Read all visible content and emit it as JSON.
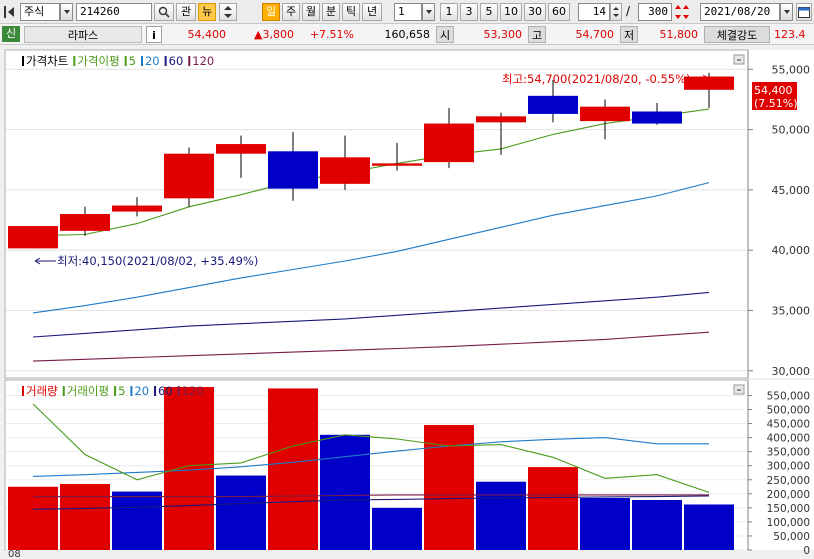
{
  "toolbar": {
    "market_type": "주식",
    "stock_code": "214260",
    "btn_gwan": "관",
    "btn_news": "뉴",
    "period_buttons": [
      "일",
      "주",
      "월",
      "분",
      "틱",
      "년"
    ],
    "interval_value": "1",
    "interval_buttons": [
      "1",
      "3",
      "5",
      "10",
      "30",
      "60"
    ],
    "count_value": "14",
    "divider": "/",
    "total_value": "300",
    "date_value": "2021/08/20"
  },
  "quote_bar": {
    "badge": "신",
    "stock_name": "라파스",
    "info_button": "i",
    "price": "54,400",
    "change": "▲3,800",
    "change_pct": "+7.51%",
    "volume": "160,658",
    "open_label": "시",
    "open": "53,300",
    "high_label": "고",
    "high": "54,700",
    "low_label": "저",
    "low": "51,800",
    "strength_label": "체결강도",
    "strength": "123.4"
  },
  "colors": {
    "up": "#e00000",
    "down": "#0000c8",
    "ma5": "#4c9a1a",
    "ma20": "#1e7ac8",
    "ma60": "#1a1a7a",
    "ma120": "#7a1a4a"
  },
  "chart_data": [
    {
      "type": "candlestick",
      "legend": [
        {
          "label": "가격차트",
          "color": "#000000"
        },
        {
          "label": "가격이평",
          "color": "#4c9a1a"
        },
        {
          "label": "5",
          "color": "#4c9a1a"
        },
        {
          "label": "20",
          "color": "#1e7ac8"
        },
        {
          "label": "60",
          "color": "#1a1a7a"
        },
        {
          "label": "120",
          "color": "#7a1a4a"
        }
      ],
      "candles": [
        {
          "o": 40150,
          "h": 42000,
          "l": 40150,
          "c": 42000,
          "dir": "up"
        },
        {
          "o": 41600,
          "h": 43600,
          "l": 41200,
          "c": 43000,
          "dir": "up"
        },
        {
          "o": 43200,
          "h": 44400,
          "l": 42800,
          "c": 43700,
          "dir": "up"
        },
        {
          "o": 44300,
          "h": 48500,
          "l": 43600,
          "c": 48000,
          "dir": "up"
        },
        {
          "o": 48000,
          "h": 49500,
          "l": 46000,
          "c": 48800,
          "dir": "up"
        },
        {
          "o": 48200,
          "h": 49800,
          "l": 44100,
          "c": 45100,
          "dir": "down"
        },
        {
          "o": 45500,
          "h": 49500,
          "l": 45000,
          "c": 47700,
          "dir": "up"
        },
        {
          "o": 47200,
          "h": 48900,
          "l": 46600,
          "c": 47000,
          "dir": "up"
        },
        {
          "o": 47300,
          "h": 51800,
          "l": 46800,
          "c": 50500,
          "dir": "up"
        },
        {
          "o": 50600,
          "h": 51400,
          "l": 47900,
          "c": 51100,
          "dir": "up"
        },
        {
          "o": 52800,
          "h": 54100,
          "l": 50600,
          "c": 51300,
          "dir": "down"
        },
        {
          "o": 50700,
          "h": 52500,
          "l": 49200,
          "c": 51900,
          "dir": "up"
        },
        {
          "o": 51500,
          "h": 52200,
          "l": 50400,
          "c": 50500,
          "dir": "down"
        },
        {
          "o": 53300,
          "h": 54700,
          "l": 51800,
          "c": 54400,
          "dir": "up"
        }
      ],
      "ma": {
        "ma5": [
          41200,
          41300,
          42200,
          43600,
          44600,
          45700,
          46400,
          47200,
          47900,
          48400,
          49600,
          50500,
          51100,
          51700
        ],
        "ma20": [
          34800,
          35400,
          36100,
          36900,
          37700,
          38400,
          39100,
          39900,
          40900,
          41900,
          42900,
          43700,
          44500,
          45600
        ],
        "ma60": [
          32800,
          33100,
          33400,
          33700,
          33900,
          34100,
          34300,
          34600,
          34900,
          35200,
          35500,
          35800,
          36100,
          36500
        ],
        "ma120": [
          30800,
          30950,
          31100,
          31250,
          31400,
          31550,
          31700,
          31850,
          32000,
          32200,
          32400,
          32600,
          32900,
          33200
        ]
      },
      "y_ticks": [
        "55,000",
        "50,000",
        "45,000",
        "40,000",
        "35,000",
        "30,000"
      ],
      "ylim": [
        29400,
        56600
      ],
      "current_price_tag": "54,400",
      "current_pct_tag": "(7.51%)",
      "annotations": {
        "high": "최고:54,700(2021/08/20, -0.55%)",
        "low": "최저:40,150(2021/08/02, +35.49%)"
      }
    },
    {
      "type": "bar",
      "legend": [
        {
          "label": "거래량",
          "color": "#e00000"
        },
        {
          "label": "거래이평",
          "color": "#4c9a1a"
        },
        {
          "label": "5",
          "color": "#4c9a1a"
        },
        {
          "label": "20",
          "color": "#1e7ac8"
        },
        {
          "label": "60",
          "color": "#1a1a7a"
        },
        {
          "label": "120",
          "color": "#7a1a4a"
        }
      ],
      "volumes": [
        225000,
        235000,
        208000,
        580000,
        265000,
        575000,
        410000,
        150000,
        445000,
        243000,
        295000,
        185000,
        178000,
        162000
      ],
      "directions": [
        "up",
        "up",
        "down",
        "up",
        "down",
        "up",
        "down",
        "down",
        "up",
        "down",
        "up",
        "down",
        "down",
        "down"
      ],
      "ma": {
        "ma5": [
          520000,
          340000,
          250000,
          300000,
          310000,
          370000,
          410000,
          395000,
          370000,
          375000,
          330000,
          255000,
          268000,
          205000
        ],
        "ma20": [
          262000,
          268000,
          276000,
          284000,
          296000,
          312000,
          332000,
          352000,
          370000,
          385000,
          394000,
          400000,
          378000,
          378000
        ],
        "ma60": [
          145000,
          148000,
          152000,
          158000,
          165000,
          172000,
          178000,
          180000,
          183000,
          185000,
          187000,
          189000,
          190000,
          192000
        ],
        "ma120": [
          190000,
          190000,
          190000,
          190000,
          190000,
          192000,
          194000,
          196000,
          196000,
          196000,
          196000,
          196000,
          196000,
          196000
        ]
      },
      "y_ticks": [
        "550,000",
        "500,000",
        "450,000",
        "400,000",
        "350,000",
        "300,000",
        "250,000",
        "200,000",
        "150,000",
        "100,000",
        "50,000",
        "0"
      ],
      "ylim": [
        0,
        605000
      ],
      "x_label": "08"
    }
  ]
}
